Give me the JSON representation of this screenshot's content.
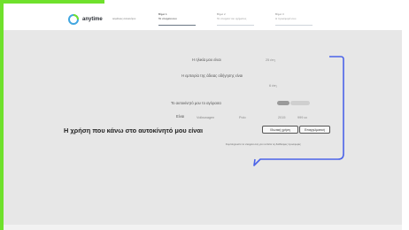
{
  "colors": {
    "accent_green": "#6fe12c",
    "bubble_blue": "#4b63e8",
    "background": "#e7e7e7"
  },
  "header": {
    "logo_text": "anytime",
    "logo_sub": "ασφάλειες αυτοκινήτου",
    "steps": [
      {
        "num": "Βήμα 1",
        "label": "Τα στοιχεία σου",
        "active": true
      },
      {
        "num": "Βήμα 2",
        "label": "Τα στοιχεία του οχήματος",
        "active": false
      },
      {
        "num": "Βήμα 3",
        "label": "Η προσφορά σου",
        "active": false
      }
    ]
  },
  "form": {
    "q1_label": "Η ηλικία μου είναι",
    "q1_value": "25 έτη",
    "q2_label_line1": "Η εμπειρία της άδειας οδήγησης είναι",
    "q2_value": "6 έτη",
    "q3_label": "Το αυτοκίνητό μου το αγόρασα",
    "q3_options": [
      "Καινούργιο",
      "Μεταχειρισμένο"
    ],
    "q4_label": "Είναι",
    "q4_values": [
      "Volkswagen",
      "Polo",
      "2015",
      "999 cc"
    ],
    "headline": "Η χρήση που κάνω στο αυτοκίνητό μου είναι",
    "use_options": [
      "Ιδιωτική χρήση",
      "Επαγγελματική"
    ],
    "note": "Συμπληρώστε τα στοιχεία σας για να δείτε τις διαθέσιμες προσφορές"
  },
  "icons": {
    "logo": "anytime-logo-icon"
  }
}
